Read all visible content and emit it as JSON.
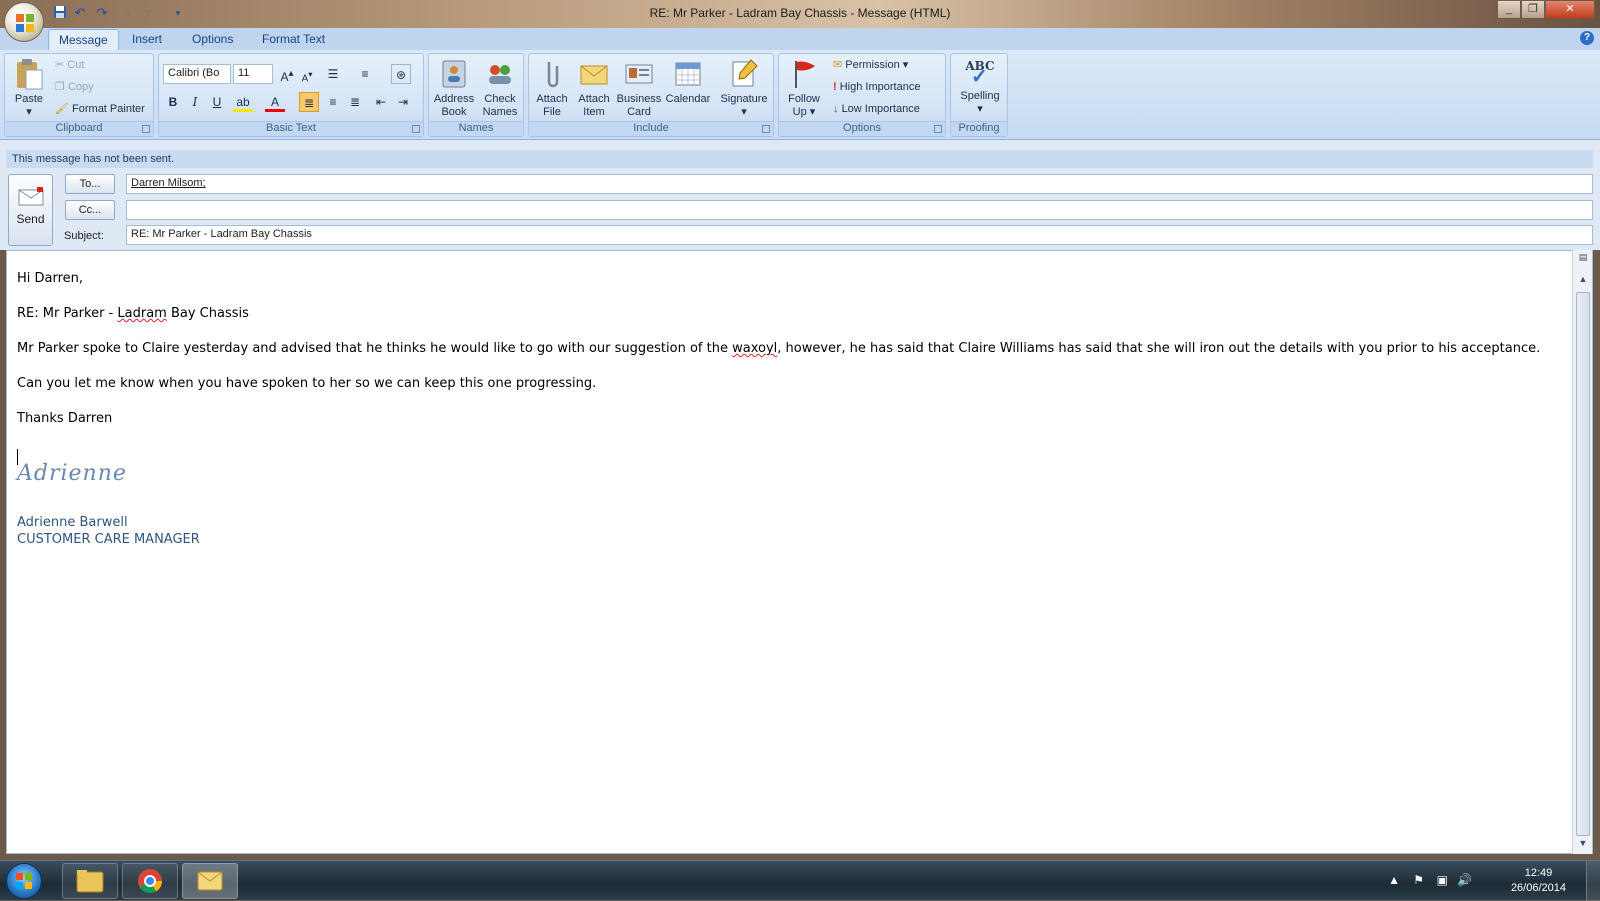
{
  "window": {
    "title": "RE: Mr Parker - Ladram Bay Chassis - Message (HTML)"
  },
  "tabs": [
    "Message",
    "Insert",
    "Options",
    "Format Text"
  ],
  "ribbon": {
    "clipboard": {
      "group_label": "Clipboard",
      "paste": "Paste",
      "cut": "Cut",
      "copy": "Copy",
      "format_painter": "Format Painter"
    },
    "basic_text": {
      "group_label": "Basic Text",
      "font": "Calibri (Bo",
      "size": "11"
    },
    "names": {
      "group_label": "Names",
      "address_book": "Address Book",
      "check_names": "Check Names"
    },
    "include": {
      "group_label": "Include",
      "attach_file": "Attach File",
      "attach_item": "Attach Item",
      "business_card": "Business Card",
      "calendar": "Calendar",
      "signature": "Signature"
    },
    "options": {
      "group_label": "Options",
      "follow_up": "Follow Up",
      "permission": "Permission",
      "high_importance": "High Importance",
      "low_importance": "Low Importance"
    },
    "proofing": {
      "group_label": "Proofing",
      "spelling": "Spelling",
      "abc": "ABC"
    }
  },
  "infobar": "This message has not been sent.",
  "header": {
    "send": "Send",
    "to_button": "To...",
    "cc_button": "Cc...",
    "to_value": "Darren Milsom;",
    "cc_value": "",
    "subject_label": "Subject:",
    "subject_value": "RE: Mr Parker - Ladram Bay Chassis"
  },
  "body": {
    "greeting": "Hi Darren,",
    "re_line_prefix": "RE: Mr Parker - ",
    "re_line_squiggle": "Ladram",
    "re_line_suffix": " Bay Chassis",
    "para1_a": "Mr Parker spoke to Claire yesterday and advised that he thinks he would like to go with our suggestion of the ",
    "para1_squiggle": "waxoyl",
    "para1_b": ", however, he has said that Claire Williams has said that she will iron out the details with you prior to his acceptance.",
    "para2": "Can you let me know when you have spoken to her so we can keep this one progressing.",
    "closing": "Thanks Darren",
    "signature_script": "Adrienne",
    "signature_name": "Adrienne Barwell",
    "signature_title": "CUSTOMER CARE MANAGER"
  },
  "taskbar": {
    "time": "12:49",
    "date": "26/06/2014"
  }
}
